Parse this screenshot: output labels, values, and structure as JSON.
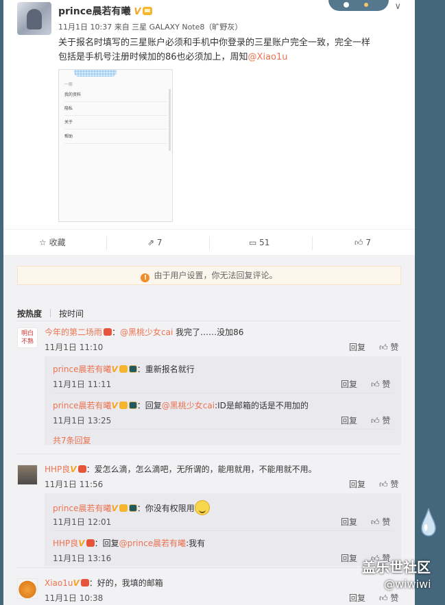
{
  "post": {
    "username": "prince晨若有曦",
    "verified": "V",
    "meta": "11月1日 10:37 来自 三星 GALAXY Note8（旷野灰）",
    "content_line1": "关于报名时填写的三星账户必须和手机中你登录的三星账户完全一致，完全一样",
    "content_line2_prefix": "包括是手机号注册时候加的86也必须加上，周知",
    "content_mention": "@Xiao1u",
    "screenshot": {
      "sub_label": "一般",
      "rows": [
        "我的资料",
        "隐私",
        "关于",
        "帮助"
      ]
    },
    "chevron": "∨"
  },
  "actions": {
    "favorite_label": "收藏",
    "forward_count": "7",
    "comment_count": "51",
    "like_count": "7"
  },
  "notice": "由于用户设置，你无法回复评论。",
  "tabs": {
    "hot": "按热度",
    "time": "按时间"
  },
  "comments": [
    {
      "avatar_text": "明白\n不熟",
      "name": "今年的第二场雨",
      "mention": "@黑桃少女cai",
      "text": " 我完了……没加86",
      "time": "11月1日 11:10",
      "replies": [
        {
          "name": "prince晨若有曦",
          "text": "：重新报名就行",
          "mention": "",
          "suffix": "",
          "time": "11月1日 11:11"
        },
        {
          "name": "prince晨若有曦",
          "text": "：回复",
          "mention": "@黑桃少女cai",
          "suffix": ":ID是邮箱的话是不用加的",
          "time": "11月1日 13:25"
        }
      ],
      "more": "共7条回复"
    },
    {
      "name": "HHP良",
      "mention": "",
      "text": "：爱怎么滴，怎么滴吧，无所谓的，能用就用，不能用就不用。",
      "time": "11月1日 11:56",
      "replies": [
        {
          "name": "prince晨若有曦",
          "text": "：你没有权限用",
          "mention": "",
          "suffix": "",
          "time": "11月1日 12:01"
        },
        {
          "name": "HHP良",
          "text": "：回复",
          "mention": "@prince晨若有曦",
          "suffix": ":我有",
          "time": "11月1日 13:16"
        }
      ]
    },
    {
      "name": "Xiao1u",
      "mention": "",
      "text": "：好的，我填的邮箱",
      "time": "11月1日 10:38",
      "replies": []
    }
  ],
  "reply_label": "回复",
  "like_label": "赞",
  "watermark": {
    "line1": "盖乐世社区",
    "line2": "@wiwiwi"
  },
  "colors": {
    "accent": "#eb7350",
    "verified": "#f6a623",
    "background": "#45677c",
    "notice_bg": "#fdf6ec",
    "notice_icon": "#f28c28"
  }
}
